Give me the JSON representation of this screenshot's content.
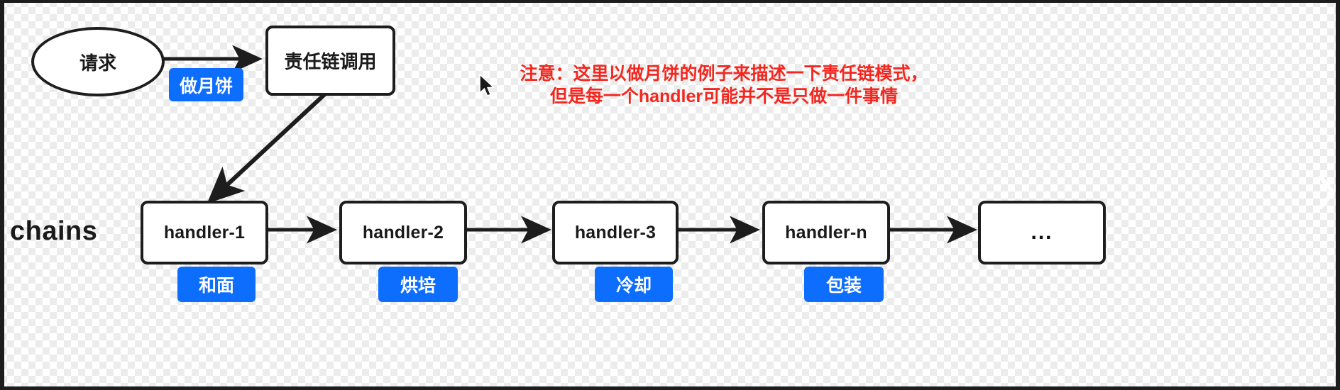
{
  "diagram": {
    "title_label": "chains",
    "request_node": {
      "label": "请求"
    },
    "call_node": {
      "label": "责任链调用"
    },
    "request_badge": {
      "label": "做月饼"
    },
    "note": "注意：这里以做月饼的例子来描述一下责任链模式，\n但是每一个handler可能并不是只做一件事情",
    "handlers": [
      {
        "label": "handler-1",
        "badge": "和面"
      },
      {
        "label": "handler-2",
        "badge": "烘培"
      },
      {
        "label": "handler-3",
        "badge": "冷却"
      },
      {
        "label": "handler-n",
        "badge": "包装"
      },
      {
        "label": "...",
        "badge": ""
      }
    ],
    "colors": {
      "badge_blue": "#0d6efd",
      "note_red": "#f3271f",
      "stroke_black": "#1d1d1d",
      "node_fill": "#ffffff",
      "bar_black": "#1d1d1d"
    },
    "icons": {
      "cursor": "mouse-pointer-icon",
      "next": "chevron-right-icon"
    }
  }
}
